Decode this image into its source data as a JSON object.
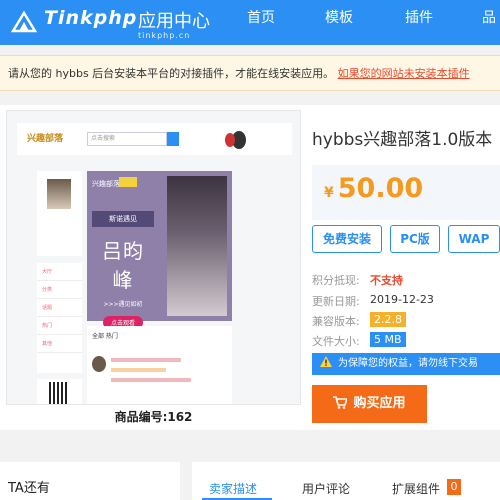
{
  "header": {
    "logo_text": "Tinkphp",
    "logo_subtitle": "应用中心",
    "logo_domain": "tinkphp.cn",
    "nav": [
      "首页",
      "模板",
      "插件",
      "品"
    ]
  },
  "notice": {
    "text": "请从您的 hybbs 后台安装本平台的对接插件，才能在线安装应用。",
    "link": "如果您的网站未安装本插件"
  },
  "preview": {
    "caption": "商品编号:162",
    "inner": {
      "logo": "兴趣部落",
      "search_placeholder": "点击搜索",
      "banner_top": "斯诺遇见",
      "banner_name": "吕昀峰",
      "banner_sub": ">>>遇见如初",
      "banner_button": "点击观看",
      "feed_tab": "全部 热门",
      "menu": [
        "大厅",
        "分类",
        "话题",
        "热门",
        "其他"
      ]
    }
  },
  "product": {
    "title": "hybbs兴趣部落1.0版本",
    "price_currency": "¥",
    "price": "50.00",
    "buttons": [
      "免费安装",
      "PC版",
      "WAP"
    ],
    "info": [
      {
        "label": "积分抵现:",
        "value": "不支持"
      },
      {
        "label": "更新日期:",
        "value": "2019-12-23"
      },
      {
        "label": "兼容版本:",
        "value": "2.2.8"
      },
      {
        "label": "文件大小:",
        "value": "5 MB"
      }
    ],
    "warning": "为保障您的权益，请勿线下交易",
    "buy_label": "购买应用"
  },
  "bottom": {
    "left_text": "TA还有",
    "tabs": [
      "卖家描述",
      "用户评论",
      "扩展组件"
    ],
    "badge": "0"
  },
  "colors": {
    "primary": "#2b8ff3",
    "price": "#f39a1f",
    "buy": "#f56a17",
    "alert": "#e84a2e"
  }
}
